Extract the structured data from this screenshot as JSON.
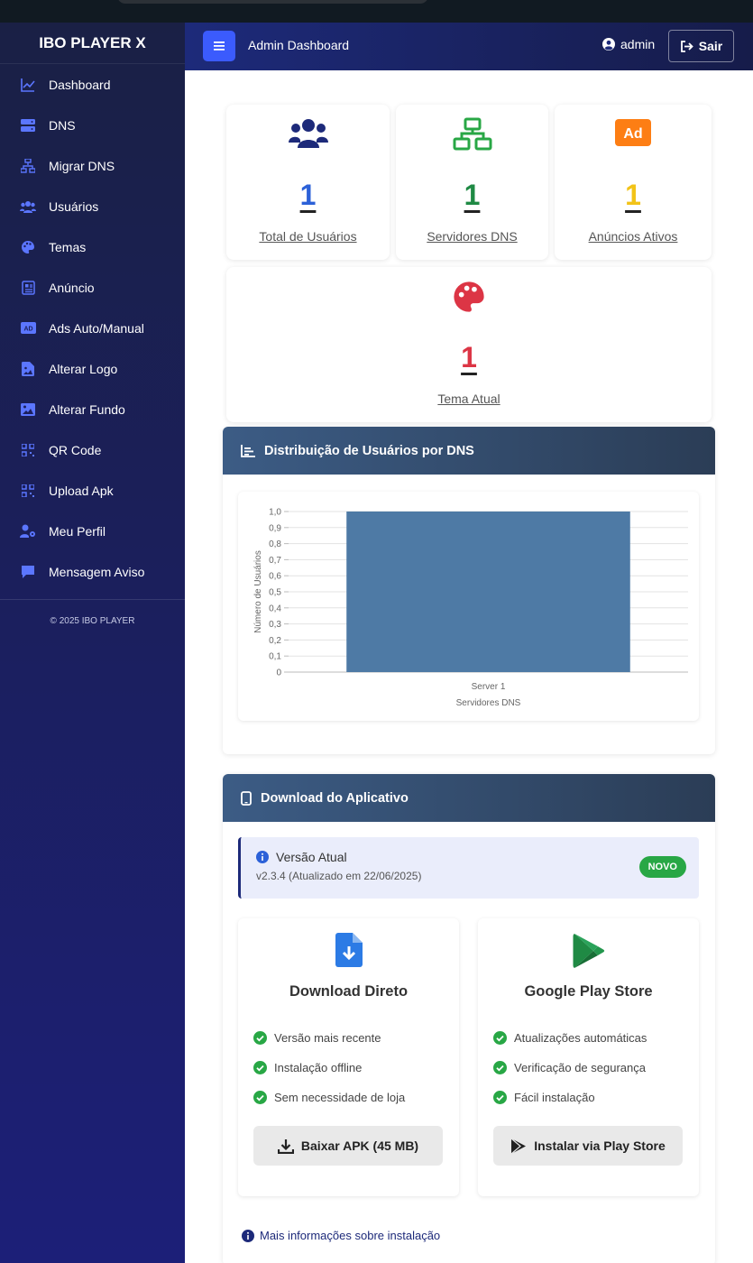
{
  "sidebar": {
    "brand": "IBO PLAYER X",
    "items": [
      {
        "label": "Dashboard",
        "icon": "chart-line-icon"
      },
      {
        "label": "DNS",
        "icon": "server-icon"
      },
      {
        "label": "Migrar DNS",
        "icon": "network-icon"
      },
      {
        "label": "Usuários",
        "icon": "users-icon"
      },
      {
        "label": "Temas",
        "icon": "palette-icon"
      },
      {
        "label": "Anúncio",
        "icon": "newspaper-icon"
      },
      {
        "label": "Ads Auto/Manual",
        "icon": "ad-icon"
      },
      {
        "label": "Alterar Logo",
        "icon": "file-image-icon"
      },
      {
        "label": "Alterar Fundo",
        "icon": "image-icon"
      },
      {
        "label": "QR Code",
        "icon": "qrcode-icon"
      },
      {
        "label": "Upload Apk",
        "icon": "qrcode-icon"
      },
      {
        "label": "Meu Perfil",
        "icon": "user-cog-icon"
      },
      {
        "label": "Mensagem Aviso",
        "icon": "comment-icon"
      }
    ],
    "copyright": "© 2025 IBO PLAYER"
  },
  "topbar": {
    "title": "Admin Dashboard",
    "user": "admin",
    "logout_label": "Sair"
  },
  "stats": [
    {
      "value": "1",
      "label": "Total de Usuários",
      "icon": "users-icon",
      "color": "#1d2a7a"
    },
    {
      "value": "1",
      "label": "Servidores DNS",
      "icon": "network-icon",
      "color": "#28a745"
    },
    {
      "value": "1",
      "label": "Anúncios Ativos",
      "icon": "ad-icon",
      "color": "#fd7e14"
    },
    {
      "value": "1",
      "label": "Tema Atual",
      "icon": "palette-icon",
      "color": "#dc3545"
    }
  ],
  "chart_panel": {
    "title": "Distribuição de Usuários por DNS"
  },
  "chart_data": {
    "type": "bar",
    "categories": [
      "Server 1"
    ],
    "values": [
      1
    ],
    "title": "",
    "xlabel": "Servidores DNS",
    "ylabel": "Número de Usuários",
    "ylim": [
      0,
      1.0
    ],
    "yticks": [
      "0",
      "0,1",
      "0,2",
      "0,3",
      "0,4",
      "0,5",
      "0,6",
      "0,7",
      "0,8",
      "0,9",
      "1,0"
    ],
    "bar_color": "#4e7aa5",
    "grid": true
  },
  "download_panel": {
    "title": "Download do Aplicativo",
    "version_title": "Versão Atual",
    "version_sub": "v2.3.4 (Atualizado em 22/06/2025)",
    "badge": "NOVO",
    "cards": [
      {
        "icon": "file-download-icon",
        "title": "Download Direto",
        "features": [
          "Versão mais recente",
          "Instalação offline",
          "Sem necessidade de loja"
        ],
        "button": "Baixar APK (45 MB)"
      },
      {
        "icon": "google-play-icon",
        "title": "Google Play Store",
        "features": [
          "Atualizações automáticas",
          "Verificação de segurança",
          "Fácil instalação"
        ],
        "button": "Instalar via Play Store"
      }
    ],
    "more_info": "Mais informações sobre instalação"
  },
  "colors": {
    "accent": "#3b5bfd",
    "success": "#28a745"
  }
}
